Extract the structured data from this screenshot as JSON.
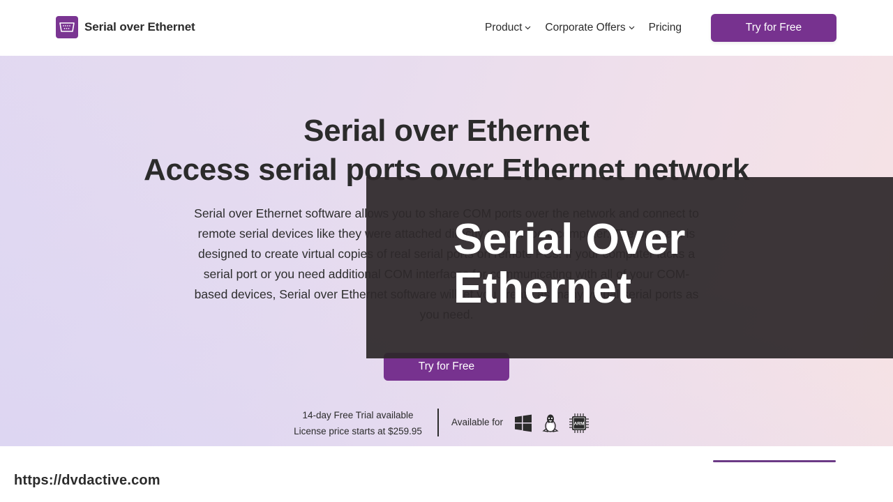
{
  "header": {
    "brand": "Serial over Ethernet",
    "logo_icon": "serial-port-icon",
    "nav": [
      {
        "label": "Product",
        "has_dropdown": true
      },
      {
        "label": "Corporate Offers",
        "has_dropdown": true
      },
      {
        "label": "Pricing",
        "has_dropdown": false
      }
    ],
    "cta_label": "Try for Free"
  },
  "hero": {
    "title_line1": "Serial over Ethernet",
    "title_line2": "Access serial ports over Ethernet network",
    "description": "Serial over Ethernet software allows you to share COM ports over the network and connect to remote serial devices like they were attached directly to your local computer. The program is designed to create virtual copies of real serial ports on remote PCs. If your computer lacks a serial port or you need additional COM interfaces for communicating with all of your COM-based devices, Serial over Ethernet software will let you create as many virtual serial ports as you need.",
    "cta_label": "Try for Free",
    "trial_line1": "14-day Free Trial available",
    "trial_line2": "License price starts at $259.95",
    "available_label": "Available for",
    "platforms": [
      "windows-icon",
      "linux-icon",
      "arm-icon"
    ]
  },
  "overlay": {
    "title": "Serial Over Ethernet"
  },
  "footer": {
    "url": "https://dvdactive.com"
  },
  "colors": {
    "brand_purple": "#77328f",
    "text_dark": "#2b2b2b",
    "overlay_bg": "#2d282a"
  }
}
